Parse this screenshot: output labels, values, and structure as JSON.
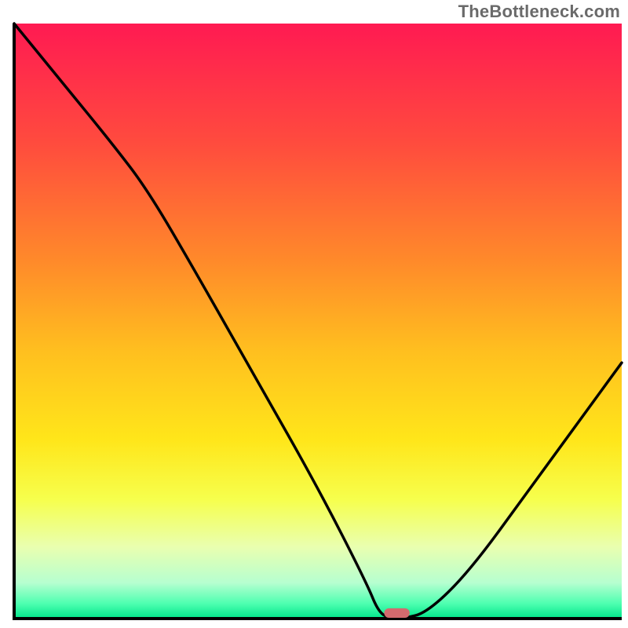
{
  "watermark": "TheBottleneck.com",
  "colors": {
    "curve": "#000000",
    "axis": "#000000",
    "marker_fill": "#d36a6e",
    "gradient_stops": [
      {
        "offset": 0.0,
        "color": "#ff1a52"
      },
      {
        "offset": 0.2,
        "color": "#ff4b3e"
      },
      {
        "offset": 0.4,
        "color": "#ff8a2a"
      },
      {
        "offset": 0.55,
        "color": "#ffbf1f"
      },
      {
        "offset": 0.7,
        "color": "#ffe61a"
      },
      {
        "offset": 0.8,
        "color": "#f6ff4d"
      },
      {
        "offset": 0.88,
        "color": "#e9ffb0"
      },
      {
        "offset": 0.94,
        "color": "#b6ffd0"
      },
      {
        "offset": 0.975,
        "color": "#4dffb0"
      },
      {
        "offset": 1.0,
        "color": "#00e58a"
      }
    ]
  },
  "chart_data": {
    "type": "line",
    "title": "",
    "xlabel": "",
    "ylabel": "",
    "xlim": [
      0,
      100
    ],
    "ylim": [
      0,
      100
    ],
    "x": [
      0,
      8,
      16,
      22,
      30,
      40,
      50,
      58,
      60,
      62,
      64,
      68,
      75,
      85,
      95,
      100
    ],
    "values": [
      100,
      90,
      80,
      72,
      58,
      40,
      22,
      6,
      1,
      0,
      0,
      1,
      8,
      22,
      36,
      43
    ],
    "optimum_marker": {
      "x": 63,
      "y": 0,
      "width": 4.2,
      "height": 1.6
    }
  }
}
